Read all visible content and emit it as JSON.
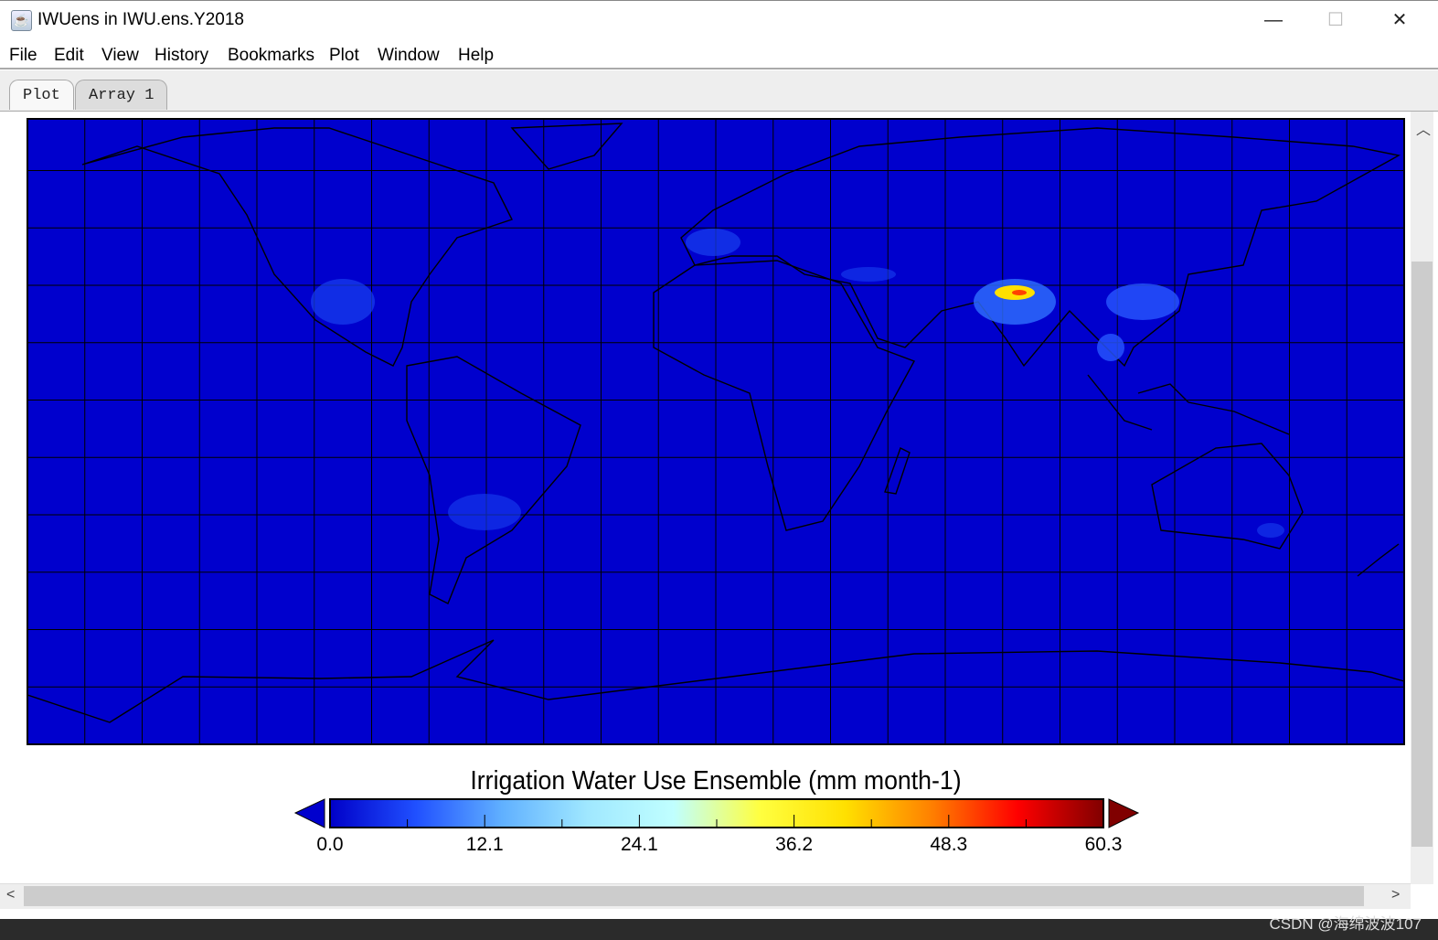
{
  "window": {
    "title": "IWUens in IWU.ens.Y2018",
    "icon": "java-cup-icon"
  },
  "menu": [
    "File",
    "Edit",
    "View",
    "History",
    "Bookmarks",
    "Plot",
    "Window",
    "Help"
  ],
  "tabs": [
    {
      "label": "Plot",
      "active": true
    },
    {
      "label": "Array 1",
      "active": false
    }
  ],
  "colorbar": {
    "title": "Irrigation Water Use Ensemble (mm month-1)",
    "ticks": [
      "0.0",
      "12.1",
      "24.1",
      "36.2",
      "48.3",
      "60.3"
    ],
    "min": 0.0,
    "max": 60.3,
    "colors": [
      "#0000c8",
      "#2050ff",
      "#60b0ff",
      "#a0e8ff",
      "#c0ffff",
      "#ffff40",
      "#ffe000",
      "#ff8000",
      "#ff0000",
      "#800000"
    ]
  },
  "map": {
    "background": "#0000cd",
    "projection": "equirectangular",
    "grid_spacing_deg": 15
  },
  "watermark": "CSDN @海绵波波107"
}
